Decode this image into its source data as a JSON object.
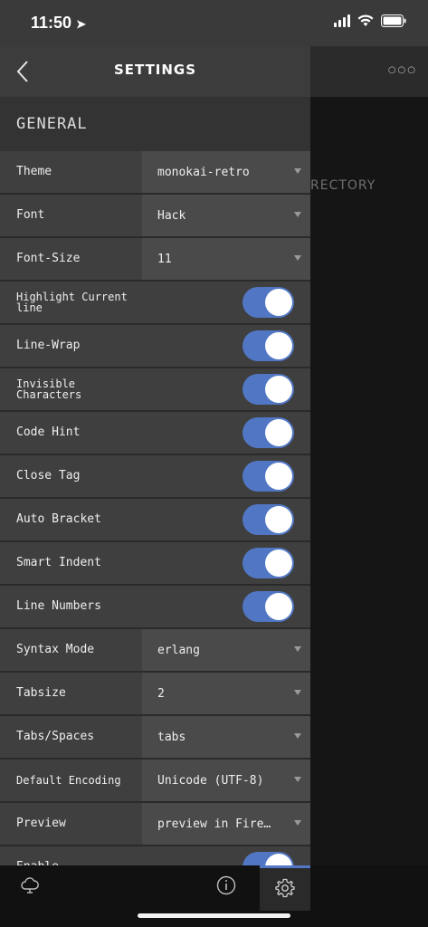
{
  "status": {
    "time": "11:50"
  },
  "header": {
    "title": "SETTINGS"
  },
  "section": {
    "title": "GENERAL"
  },
  "background": {
    "partial_text": "RECTORY"
  },
  "rows": [
    {
      "label": "Theme",
      "type": "select",
      "value": "monokai-retro"
    },
    {
      "label": "Font",
      "type": "select",
      "value": "Hack"
    },
    {
      "label": "Font-Size",
      "type": "select",
      "value": "11"
    },
    {
      "label": "Highlight Current line",
      "type": "toggle",
      "on": true
    },
    {
      "label": "Line-Wrap",
      "type": "toggle",
      "on": true
    },
    {
      "label": "Invisible Characters",
      "type": "toggle",
      "on": true
    },
    {
      "label": "Code Hint",
      "type": "toggle",
      "on": true
    },
    {
      "label": "Close Tag",
      "type": "toggle",
      "on": true
    },
    {
      "label": "Auto Bracket",
      "type": "toggle",
      "on": true
    },
    {
      "label": "Smart Indent",
      "type": "toggle",
      "on": true
    },
    {
      "label": "Line Numbers",
      "type": "toggle",
      "on": true
    },
    {
      "label": "Syntax Mode",
      "type": "select",
      "value": "erlang"
    },
    {
      "label": "Tabsize",
      "type": "select",
      "value": "2"
    },
    {
      "label": "Tabs/Spaces",
      "type": "select",
      "value": "tabs"
    },
    {
      "label": "Default Encoding",
      "type": "select",
      "value": "Unicode (UTF-8)"
    },
    {
      "label": "Preview",
      "type": "select",
      "value": "preview in Fire…"
    },
    {
      "label": "Enable",
      "type": "toggle",
      "on": true
    }
  ],
  "colors": {
    "accent": "#5177c4",
    "panel": "#3c3c3c",
    "row": "#3f3f3f",
    "select": "#4a4a4a"
  },
  "tabbar": {
    "icons": [
      "cloud-icon",
      "info-icon",
      "gear-icon"
    ],
    "active": "gear-icon"
  }
}
